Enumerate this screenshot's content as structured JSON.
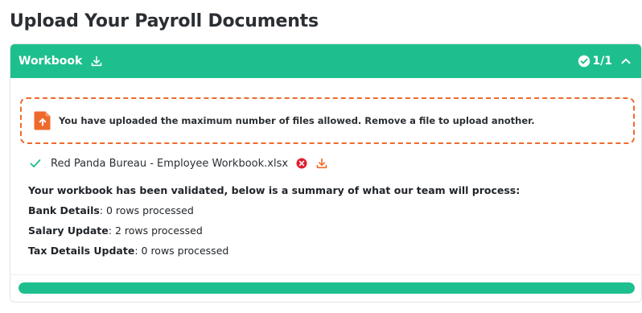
{
  "page": {
    "title": "Upload Your Payroll Documents"
  },
  "panel": {
    "title": "Workbook",
    "count": "1/1",
    "colors": {
      "header": "#1ebf8e",
      "accent": "#ee6a2c"
    },
    "icons": {
      "download": "download-icon",
      "check_circle": "check-circle-icon",
      "collapse": "chevron-up-icon"
    }
  },
  "notice": {
    "icon": "upload-file-icon",
    "text": "You have uploaded the maximum number of files allowed. Remove a file to upload another."
  },
  "file": {
    "status_icon": "check-icon",
    "name": "Red Panda Bureau - Employee Workbook.xlsx",
    "remove_icon": "remove-icon",
    "download_icon": "download-icon"
  },
  "summary": {
    "heading": "Your workbook has been validated, below is a summary of what our team will process:",
    "items": [
      {
        "label": "Bank Details",
        "value": ": 0 rows processed"
      },
      {
        "label": "Salary Update",
        "value": ": 2 rows processed"
      },
      {
        "label": "Tax Details Update",
        "value": ": 0 rows processed"
      }
    ]
  },
  "progress": {
    "percent": 100
  }
}
